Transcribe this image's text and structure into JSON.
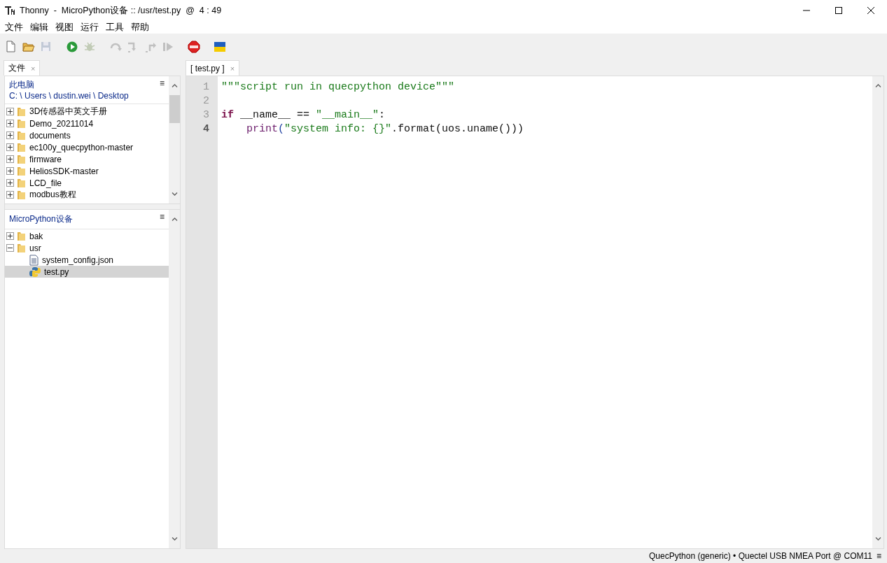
{
  "window": {
    "title": "Thonny  -  MicroPython设备 :: /usr/test.py  @  4 : 49"
  },
  "menu": [
    "文件",
    "编辑",
    "视图",
    "运行",
    "工具",
    "帮助"
  ],
  "toolbar": [
    {
      "kind": "new",
      "disabled": false
    },
    {
      "kind": "open",
      "disabled": false
    },
    {
      "kind": "save",
      "disabled": true
    },
    {
      "kind": "run",
      "disabled": false
    },
    {
      "kind": "debug",
      "disabled": true
    },
    {
      "kind": "step-over",
      "disabled": true
    },
    {
      "kind": "step-into",
      "disabled": true
    },
    {
      "kind": "step-out",
      "disabled": true
    },
    {
      "kind": "resume",
      "disabled": true
    },
    {
      "kind": "stop",
      "disabled": false
    },
    {
      "kind": "flag",
      "disabled": false
    }
  ],
  "left_tabs": [
    {
      "label": "文件",
      "close": "×",
      "selected": true
    }
  ],
  "local_files": {
    "title": "此电脑",
    "menu": "≡",
    "path": "C: \\ Users \\ dustin.wei \\ Desktop",
    "items": [
      {
        "kind": "folder",
        "name": "3D传感器中英文手册",
        "expanded": false,
        "selected": false
      },
      {
        "kind": "folder",
        "name": "Demo_20211014",
        "expanded": false,
        "selected": false
      },
      {
        "kind": "folder",
        "name": "documents",
        "expanded": false,
        "selected": false
      },
      {
        "kind": "folder",
        "name": "ec100y_quecpython-master",
        "expanded": false,
        "selected": false
      },
      {
        "kind": "folder",
        "name": "firmware",
        "expanded": false,
        "selected": false
      },
      {
        "kind": "folder",
        "name": "HeliosSDK-master",
        "expanded": false,
        "selected": false
      },
      {
        "kind": "folder",
        "name": "LCD_file",
        "expanded": false,
        "selected": false
      },
      {
        "kind": "folder",
        "name": "modbus教程",
        "expanded": false,
        "selected": false
      }
    ]
  },
  "device_files": {
    "title": "MicroPython设备",
    "menu": "≡",
    "items": [
      {
        "kind": "folder",
        "name": "bak",
        "expanded": false,
        "selected": false
      },
      {
        "kind": "folder",
        "name": "usr",
        "expanded": true,
        "selected": false,
        "children": [
          {
            "kind": "file",
            "name": "system_config.json",
            "selected": false
          },
          {
            "kind": "python",
            "name": "test.py",
            "selected": true
          }
        ]
      }
    ]
  },
  "editor_tabs": [
    {
      "label": "[ test.py ]",
      "close": "×",
      "selected": true
    }
  ],
  "editor": {
    "lines": [
      {
        "number": "1",
        "current": false,
        "tokens": [
          {
            "kind": "string",
            "text": "\"\"\"script run in quecpython device\"\"\""
          }
        ]
      },
      {
        "number": "2",
        "current": false
      },
      {
        "number": "3",
        "current": false,
        "tokens": [
          {
            "kind": "keyword",
            "text": "if"
          },
          {
            "kind": "plain",
            "text": " __name__ == "
          },
          {
            "kind": "string",
            "text": "\"__main__\""
          },
          {
            "kind": "plain",
            "text": ":"
          }
        ]
      },
      {
        "number": "4",
        "current": true,
        "indent": true,
        "tokens": [
          {
            "kind": "builtin",
            "text": "print"
          },
          {
            "kind": "paren",
            "text": "("
          },
          {
            "kind": "string",
            "text": "\"system info: {}\""
          },
          {
            "kind": "plain",
            "text": ".format(uos.uname()))"
          }
        ]
      }
    ]
  },
  "status_bar": {
    "text": "QuecPython (generic)  •  Quectel USB NMEA Port @ COM11",
    "menu": "≡"
  }
}
